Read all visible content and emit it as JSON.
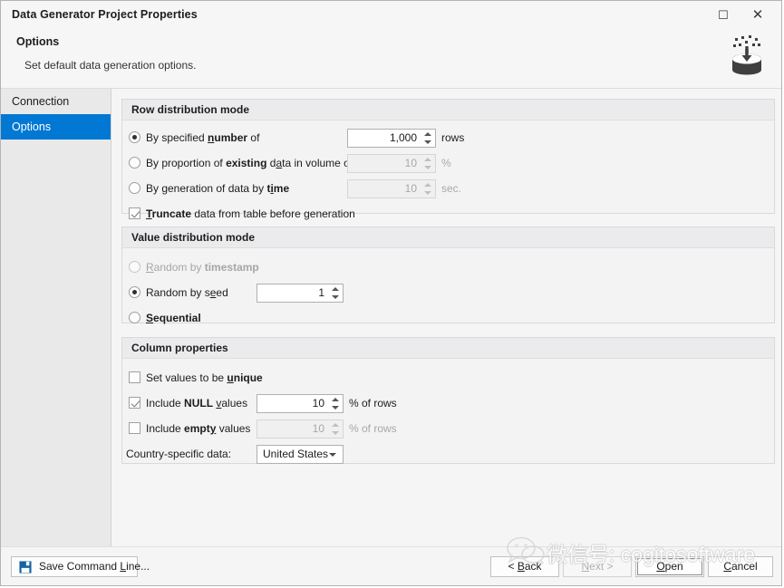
{
  "window": {
    "title": "Data Generator Project Properties",
    "maximize_icon": "maximize-icon",
    "close_icon": "close-icon"
  },
  "header": {
    "heading": "Options",
    "subheading": "Set default data generation options.",
    "icon": "data-generator-icon"
  },
  "sidebar": {
    "items": [
      {
        "label": "Connection",
        "selected": false
      },
      {
        "label": "Options",
        "selected": true
      }
    ],
    "selected_color": "#0078d4"
  },
  "panels": {
    "row_distribution": {
      "title": "Row distribution mode",
      "options": [
        {
          "label_html": "By specified <b><u>n</u>umber</b> of",
          "selected": true,
          "enabled": true,
          "value": "1,000",
          "unit": "rows",
          "field_enabled": true
        },
        {
          "label_html": "By proportion of <b>existing</b> d<u>a</u>ta in volume of",
          "selected": false,
          "enabled": true,
          "value": "10",
          "unit": "%",
          "field_enabled": false
        },
        {
          "label_html": "By generation of data by <b>t<u>i</u>me</b>",
          "selected": false,
          "enabled": true,
          "value": "10",
          "unit": "sec.",
          "field_enabled": false
        }
      ],
      "truncate": {
        "label_html": "<b><u>T</u>runcate</b> data from table before generation",
        "checked": true
      }
    },
    "value_distribution": {
      "title": "Value distribution mode",
      "options": [
        {
          "label_html": "<u>R</u>andom by <b>timestamp</b>",
          "selected": false,
          "dim": true,
          "has_field": false
        },
        {
          "label_html": "Random by s<u>e</u>ed",
          "selected": true,
          "dim": false,
          "has_field": true,
          "value": "1"
        },
        {
          "label_html": "<b><u>S</u>equential</b>",
          "selected": false,
          "dim": false,
          "has_field": false
        }
      ]
    },
    "column_properties": {
      "title": "Column properties",
      "unique": {
        "label_html": "Set values to be <b><u>u</u>nique</b>",
        "checked": false
      },
      "null_values": {
        "label_html": "Include <b>NULL</b> <u>v</u>alues",
        "checked": true,
        "value": "10",
        "unit": "% of rows",
        "field_enabled": true
      },
      "empty_values": {
        "label_html": "Include <b>empt<u>y</u></b> values",
        "checked": false,
        "value": "10",
        "unit": "% of rows",
        "field_enabled": false
      },
      "country": {
        "label": "Country-specific data:",
        "value": "United States"
      }
    }
  },
  "footer": {
    "save_command_line": "Save Command Line...",
    "save_icon": "floppy-disk-save-icon",
    "back": "< Back",
    "next": "Next >",
    "open": "Open",
    "cancel": "Cancel"
  },
  "watermark": {
    "text": "微信号: cogitosoftware",
    "logo": "wechat-logo-icon"
  }
}
